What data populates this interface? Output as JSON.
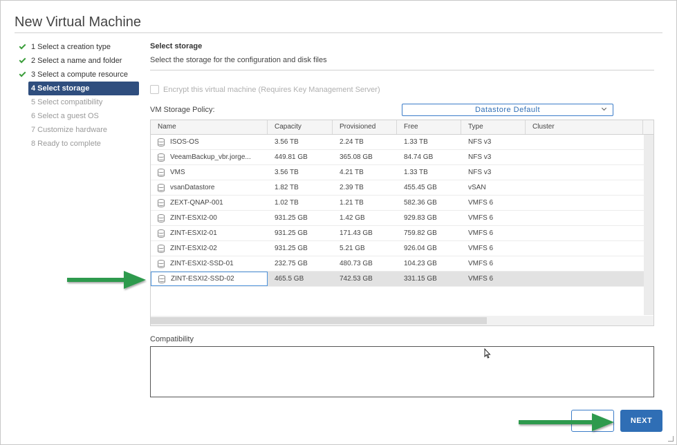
{
  "window": {
    "title": "New Virtual Machine"
  },
  "steps": [
    {
      "label": "1 Select a creation type",
      "state": "done"
    },
    {
      "label": "2 Select a name and folder",
      "state": "done"
    },
    {
      "label": "3 Select a compute resource",
      "state": "done"
    },
    {
      "label": "4 Select storage",
      "state": "current"
    },
    {
      "label": "5 Select compatibility",
      "state": "pending"
    },
    {
      "label": "6 Select a guest OS",
      "state": "pending"
    },
    {
      "label": "7 Customize hardware",
      "state": "pending"
    },
    {
      "label": "8 Ready to complete",
      "state": "pending"
    }
  ],
  "section": {
    "title": "Select storage",
    "description": "Select the storage for the configuration and disk files"
  },
  "encrypt": {
    "label": "Encrypt this virtual machine (Requires Key Management Server)",
    "checked": false,
    "enabled": false
  },
  "policy": {
    "label": "VM Storage Policy:",
    "selected": "Datastore Default"
  },
  "grid": {
    "columns": [
      "Name",
      "Capacity",
      "Provisioned",
      "Free",
      "Type",
      "Cluster"
    ],
    "rows": [
      {
        "name": "ISOS-OS",
        "capacity": "3.56 TB",
        "provisioned": "2.24 TB",
        "free": "1.33 TB",
        "type": "NFS v3",
        "cluster": ""
      },
      {
        "name": "VeeamBackup_vbr.jorge...",
        "capacity": "449.81 GB",
        "provisioned": "365.08 GB",
        "free": "84.74 GB",
        "type": "NFS v3",
        "cluster": ""
      },
      {
        "name": "VMS",
        "capacity": "3.56 TB",
        "provisioned": "4.21 TB",
        "free": "1.33 TB",
        "type": "NFS v3",
        "cluster": ""
      },
      {
        "name": "vsanDatastore",
        "capacity": "1.82 TB",
        "provisioned": "2.39 TB",
        "free": "455.45 GB",
        "type": "vSAN",
        "cluster": ""
      },
      {
        "name": "ZEXT-QNAP-001",
        "capacity": "1.02 TB",
        "provisioned": "1.21 TB",
        "free": "582.36 GB",
        "type": "VMFS 6",
        "cluster": ""
      },
      {
        "name": "ZINT-ESXI2-00",
        "capacity": "931.25 GB",
        "provisioned": "1.42 GB",
        "free": "929.83 GB",
        "type": "VMFS 6",
        "cluster": ""
      },
      {
        "name": "ZINT-ESXI2-01",
        "capacity": "931.25 GB",
        "provisioned": "171.43 GB",
        "free": "759.82 GB",
        "type": "VMFS 6",
        "cluster": ""
      },
      {
        "name": "ZINT-ESXI2-02",
        "capacity": "931.25 GB",
        "provisioned": "5.21 GB",
        "free": "926.04 GB",
        "type": "VMFS 6",
        "cluster": ""
      },
      {
        "name": "ZINT-ESXI2-SSD-01",
        "capacity": "232.75 GB",
        "provisioned": "480.73 GB",
        "free": "104.23 GB",
        "type": "VMFS 6",
        "cluster": ""
      },
      {
        "name": "ZINT-ESXI2-SSD-02",
        "capacity": "465.5 GB",
        "provisioned": "742.53 GB",
        "free": "331.15 GB",
        "type": "VMFS 6",
        "cluster": "",
        "selected": true
      }
    ]
  },
  "compatibility": {
    "label": "Compatibility",
    "text": ""
  },
  "buttons": {
    "cancel": "",
    "next": "NEXT"
  },
  "colors": {
    "accent": "#2f6eb5",
    "step_current": "#2f4e7e",
    "check": "#3b9e3b",
    "arrow": "#2e9a4e"
  },
  "icons": {
    "row": "datastore-icon",
    "done": "check-icon",
    "annotation": "arrow-icon"
  }
}
